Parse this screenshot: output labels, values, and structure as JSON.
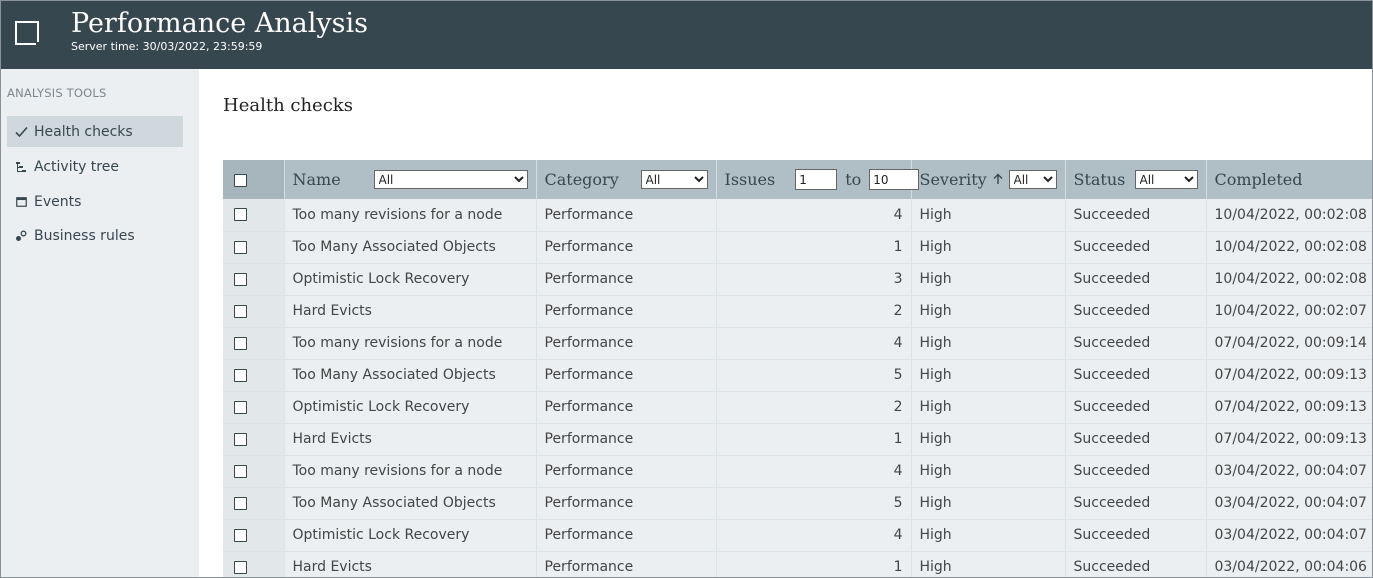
{
  "header": {
    "title": "Performance Analysis",
    "server_time": "Server time: 30/03/2022, 23:59:59"
  },
  "sidebar": {
    "heading": "ANALYSIS TOOLS",
    "items": [
      {
        "label": "Health checks",
        "icon": "check-icon",
        "active": true
      },
      {
        "label": "Activity tree",
        "icon": "tree-icon",
        "active": false
      },
      {
        "label": "Events",
        "icon": "calendar-icon",
        "active": false
      },
      {
        "label": "Business rules",
        "icon": "rules-icon",
        "active": false
      }
    ]
  },
  "main": {
    "title": "Health checks"
  },
  "table": {
    "columns": {
      "name": "Name",
      "category": "Category",
      "issues": "Issues",
      "issues_to": "to",
      "severity": "Severity",
      "status": "Status",
      "completed": "Completed"
    },
    "filters": {
      "name": "All",
      "category": "All",
      "issues_from": "1",
      "issues_to": "10",
      "severity": "All",
      "status": "All"
    },
    "sort": {
      "column": "Severity",
      "direction": "ascending"
    },
    "rows": [
      {
        "name": "Too many revisions for a node",
        "category": "Performance",
        "issues": "4",
        "severity": "High",
        "status": "Succeeded",
        "completed": "10/04/2022, 00:02:08"
      },
      {
        "name": "Too Many Associated Objects",
        "category": "Performance",
        "issues": "1",
        "severity": "High",
        "status": "Succeeded",
        "completed": "10/04/2022, 00:02:08"
      },
      {
        "name": "Optimistic Lock Recovery",
        "category": "Performance",
        "issues": "3",
        "severity": "High",
        "status": "Succeeded",
        "completed": "10/04/2022, 00:02:08"
      },
      {
        "name": "Hard Evicts",
        "category": "Performance",
        "issues": "2",
        "severity": "High",
        "status": "Succeeded",
        "completed": "10/04/2022, 00:02:07"
      },
      {
        "name": "Too many revisions for a node",
        "category": "Performance",
        "issues": "4",
        "severity": "High",
        "status": "Succeeded",
        "completed": "07/04/2022, 00:09:14"
      },
      {
        "name": "Too Many Associated Objects",
        "category": "Performance",
        "issues": "5",
        "severity": "High",
        "status": "Succeeded",
        "completed": "07/04/2022, 00:09:13"
      },
      {
        "name": "Optimistic Lock Recovery",
        "category": "Performance",
        "issues": "2",
        "severity": "High",
        "status": "Succeeded",
        "completed": "07/04/2022, 00:09:13"
      },
      {
        "name": "Hard Evicts",
        "category": "Performance",
        "issues": "1",
        "severity": "High",
        "status": "Succeeded",
        "completed": "07/04/2022, 00:09:13"
      },
      {
        "name": "Too many revisions for a node",
        "category": "Performance",
        "issues": "4",
        "severity": "High",
        "status": "Succeeded",
        "completed": "03/04/2022, 00:04:07"
      },
      {
        "name": "Too Many Associated Objects",
        "category": "Performance",
        "issues": "5",
        "severity": "High",
        "status": "Succeeded",
        "completed": "03/04/2022, 00:04:07"
      },
      {
        "name": "Optimistic Lock Recovery",
        "category": "Performance",
        "issues": "4",
        "severity": "High",
        "status": "Succeeded",
        "completed": "03/04/2022, 00:04:07"
      },
      {
        "name": "Hard Evicts",
        "category": "Performance",
        "issues": "1",
        "severity": "High",
        "status": "Succeeded",
        "completed": "03/04/2022, 00:04:06"
      }
    ]
  },
  "colors": {
    "header_bg": "#37474f",
    "sidebar_bg": "#eceff1",
    "active_item_bg": "#cfd8dc",
    "table_header_bg": "#b0bec5"
  }
}
